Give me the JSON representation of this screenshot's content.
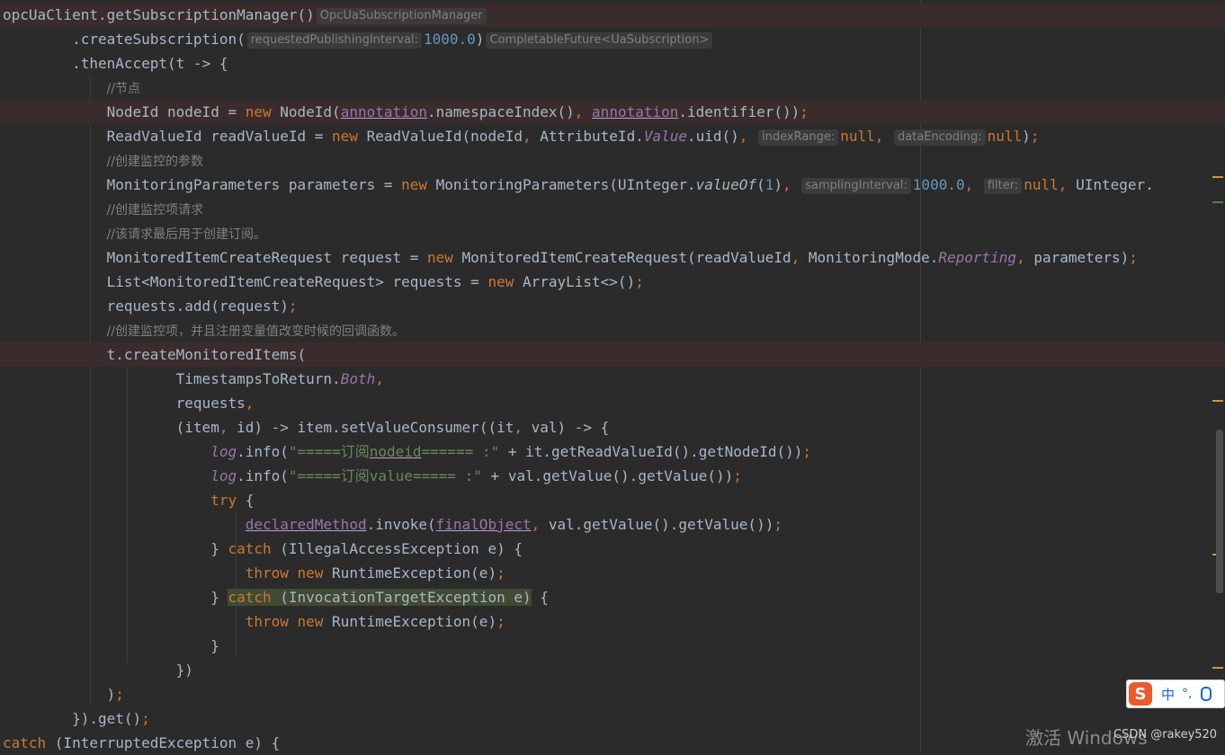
{
  "lines": [
    [
      [
        "id",
        "opcUaClient.getSubscriptionManager()"
      ],
      [
        "hint",
        "OpcUaSubscriptionManager"
      ]
    ],
    [
      [
        "id",
        "        .createSubscription("
      ],
      [
        "hint",
        "requestedPublishingInterval:"
      ],
      [
        "nu",
        "1000.0"
      ],
      [
        "id",
        ")"
      ],
      [
        "hint",
        "CompletableFuture<UaSubscription>"
      ]
    ],
    [
      [
        "id",
        "        .thenAccept(t -> {"
      ]
    ],
    [
      [
        "id",
        "            "
      ],
      [
        "cm",
        "//节点"
      ]
    ],
    [
      [
        "id",
        "            NodeId nodeId = "
      ],
      [
        "kw",
        "new "
      ],
      [
        "id",
        "NodeId("
      ],
      [
        "fldul",
        "annotation"
      ],
      [
        "id",
        ".namespaceIndex()"
      ],
      [
        "pu",
        ", "
      ],
      [
        "fldul",
        "annotation"
      ],
      [
        "id",
        ".identifier())"
      ],
      [
        "pu",
        ";"
      ]
    ],
    [
      [
        "id",
        "            ReadValueId readValueId = "
      ],
      [
        "kw",
        "new "
      ],
      [
        "id",
        "ReadValueId(nodeId"
      ],
      [
        "pu",
        ", "
      ],
      [
        "id",
        "AttributeId."
      ],
      [
        "fli",
        "Value"
      ],
      [
        "id",
        ".uid()"
      ],
      [
        "pu",
        ", "
      ],
      [
        "hint",
        "indexRange:"
      ],
      [
        "kw",
        "null"
      ],
      [
        "pu",
        ", "
      ],
      [
        "hint",
        "dataEncoding:"
      ],
      [
        "kw",
        "null"
      ],
      [
        "id",
        ")"
      ],
      [
        "pu",
        ";"
      ]
    ],
    [
      [
        "id",
        "            "
      ],
      [
        "cm",
        "//创建监控的参数"
      ]
    ],
    [
      [
        "id",
        "            MonitoringParameters parameters = "
      ],
      [
        "kw",
        "new "
      ],
      [
        "id",
        "MonitoringParameters(UInteger."
      ],
      [
        "sti",
        "valueOf"
      ],
      [
        "id",
        "("
      ],
      [
        "nu",
        "1"
      ],
      [
        "id",
        ")"
      ],
      [
        "pu",
        ", "
      ],
      [
        "hint",
        "samplingInterval:"
      ],
      [
        "nu",
        "1000.0"
      ],
      [
        "pu",
        ", "
      ],
      [
        "hint",
        "filter:"
      ],
      [
        "kw",
        "null"
      ],
      [
        "pu",
        ", "
      ],
      [
        "id",
        "UInteger."
      ]
    ],
    [
      [
        "id",
        "            "
      ],
      [
        "cm",
        "//创建监控项请求"
      ]
    ],
    [
      [
        "id",
        "            "
      ],
      [
        "cm",
        "//该请求最后用于创建订阅。"
      ]
    ],
    [
      [
        "id",
        "            MonitoredItemCreateRequest request = "
      ],
      [
        "kw",
        "new "
      ],
      [
        "id",
        "MonitoredItemCreateRequest(readValueId"
      ],
      [
        "pu",
        ", "
      ],
      [
        "id",
        "MonitoringMode."
      ],
      [
        "fli",
        "Reporting"
      ],
      [
        "pu",
        ", "
      ],
      [
        "id",
        "parameters)"
      ],
      [
        "pu",
        ";"
      ]
    ],
    [
      [
        "id",
        "            List<MonitoredItemCreateRequest> requests = "
      ],
      [
        "kw",
        "new "
      ],
      [
        "id",
        "ArrayList<>()"
      ],
      [
        "pu",
        ";"
      ]
    ],
    [
      [
        "id",
        "            requests.add(request)"
      ],
      [
        "pu",
        ";"
      ]
    ],
    [
      [
        "id",
        "            "
      ],
      [
        "cm",
        "//创建监控项，并且注册变量值改变时候的回调函数。"
      ]
    ],
    [
      [
        "id",
        "            t.createMonitoredItems("
      ]
    ],
    [
      [
        "id",
        "                    TimestampsToReturn."
      ],
      [
        "fli",
        "Both"
      ],
      [
        "pu",
        ","
      ]
    ],
    [
      [
        "id",
        "                    requests"
      ],
      [
        "pu",
        ","
      ]
    ],
    [
      [
        "id",
        "                    (item"
      ],
      [
        "pu",
        ", "
      ],
      [
        "id",
        "id) -> item.setValueConsumer((it"
      ],
      [
        "pu",
        ", "
      ],
      [
        "id",
        "val) -> {"
      ]
    ],
    [
      [
        "id",
        "                        "
      ],
      [
        "fli",
        "log"
      ],
      [
        "id",
        ".info("
      ],
      [
        "st",
        "\"=====订阅"
      ],
      [
        "stul",
        "nodeid"
      ],
      [
        "st",
        "====== :\""
      ],
      [
        "id",
        " + it.getReadValueId().getNodeId())"
      ],
      [
        "pu",
        ";"
      ]
    ],
    [
      [
        "id",
        "                        "
      ],
      [
        "fli",
        "log"
      ],
      [
        "id",
        ".info("
      ],
      [
        "st",
        "\"=====订阅value===== :\""
      ],
      [
        "id",
        " + val.getValue().getValue())"
      ],
      [
        "pu",
        ";"
      ]
    ],
    [
      [
        "id",
        "                        "
      ],
      [
        "kw",
        "try "
      ],
      [
        "id",
        "{"
      ]
    ],
    [
      [
        "id",
        "                            "
      ],
      [
        "fldul",
        "declaredMethod"
      ],
      [
        "id",
        ".invoke("
      ],
      [
        "fldul",
        "finalObject"
      ],
      [
        "pu",
        ", "
      ],
      [
        "id",
        "val.getValue().getValue())"
      ],
      [
        "pu",
        ";"
      ]
    ],
    [
      [
        "id",
        "                        } "
      ],
      [
        "kw",
        "catch "
      ],
      [
        "id",
        "(IllegalAccessException e) {"
      ]
    ],
    [
      [
        "id",
        "                            "
      ],
      [
        "kw",
        "throw new "
      ],
      [
        "id",
        "RuntimeException(e)"
      ],
      [
        "pu",
        ";"
      ]
    ],
    [
      [
        "id",
        "                        } "
      ],
      [
        "kwm",
        "catch"
      ],
      [
        "idm",
        " (InvocationTargetException e)"
      ],
      [
        "id",
        " {"
      ]
    ],
    [
      [
        "id",
        "                            "
      ],
      [
        "kw",
        "throw new "
      ],
      [
        "id",
        "RuntimeException(e)"
      ],
      [
        "pu",
        ";"
      ]
    ],
    [
      [
        "id",
        "                        }"
      ]
    ],
    [
      [
        "id",
        "                    })"
      ]
    ],
    [
      [
        "id",
        "            )"
      ],
      [
        "pu",
        ";"
      ]
    ],
    [
      [
        "id",
        "        }).get()"
      ],
      [
        "pu",
        ";"
      ]
    ],
    [
      [
        "kw",
        "catch "
      ],
      [
        "id",
        "(InterruptedException e) {"
      ]
    ]
  ],
  "highlighted_lines": [
    0,
    4,
    14
  ],
  "ime": {
    "logo": "S",
    "mode": "中",
    "punct": "°,"
  },
  "watermark": "激活 Windows",
  "csdn": "CSDN @rakey520",
  "colors": {
    "background": "#2b2b2b",
    "keyword": "#cc7832",
    "string": "#6a8759",
    "number": "#6897bb",
    "field": "#9876aa",
    "comment": "#808080",
    "text": "#a9b7c6"
  }
}
